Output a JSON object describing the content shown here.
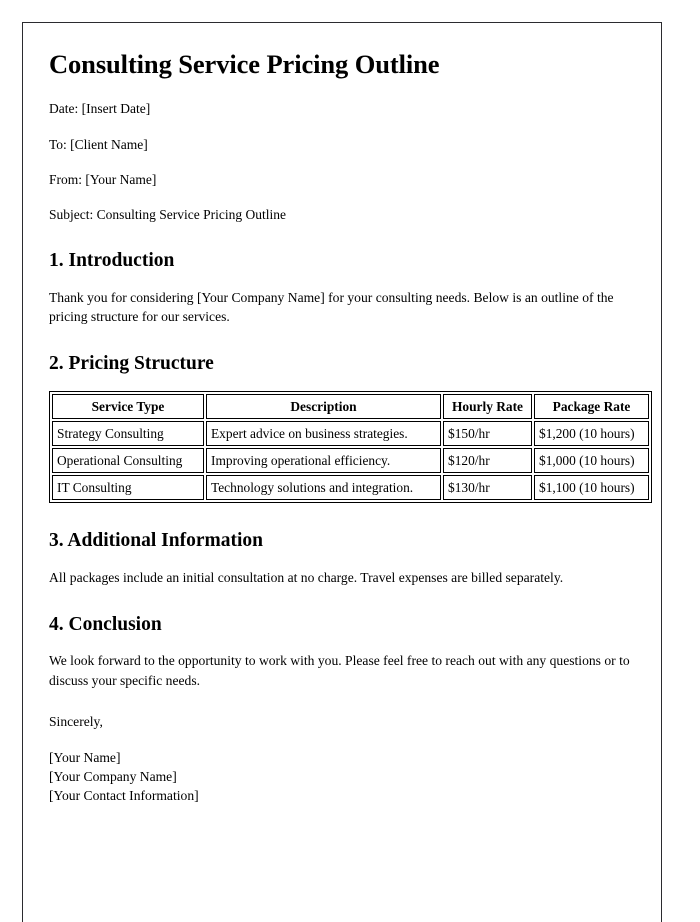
{
  "document": {
    "title": "Consulting Service Pricing Outline",
    "meta": [
      {
        "label": "Date",
        "text": "Date: [Insert Date]"
      },
      {
        "label": "To",
        "text": "To: [Client Name]"
      },
      {
        "label": "From",
        "text": "From: [Your Name]"
      },
      {
        "label": "Subject",
        "text": "Subject: Consulting Service Pricing Outline"
      }
    ],
    "sections": {
      "introduction": {
        "heading": "1. Introduction",
        "paragraph": "Thank you for considering [Your Company Name] for your consulting needs. Below is an outline of the pricing structure for our services."
      },
      "pricing_structure": {
        "heading": "2. Pricing Structure",
        "table": {
          "columns": [
            "Service Type",
            "Description",
            "Hourly Rate",
            "Package Rate"
          ],
          "rows": [
            {
              "service_type": "Strategy Consulting",
              "description": "Expert advice on business strategies.",
              "hourly_rate": "$150/hr",
              "package_rate": "$1,200 (10 hours)"
            },
            {
              "service_type": "Operational Consulting",
              "description": "Improving operational efficiency.",
              "hourly_rate": "$120/hr",
              "package_rate": "$1,000 (10 hours)"
            },
            {
              "service_type": "IT Consulting",
              "description": "Technology solutions and integration.",
              "hourly_rate": "$130/hr",
              "package_rate": "$1,100 (10 hours)"
            }
          ]
        }
      },
      "additional_information": {
        "heading": "3. Additional Information",
        "paragraph": "All packages include an initial consultation at no charge. Travel expenses are billed separately."
      },
      "conclusion": {
        "heading": "4. Conclusion",
        "paragraph": "We look forward to the opportunity to work with you. Please feel free to reach out with any questions or to discuss your specific needs.",
        "sign_off": "Sincerely,",
        "signature": [
          "[Your Name]",
          "[Your Company Name]",
          "[Your Contact Information]"
        ]
      }
    }
  },
  "colors": {
    "page_background": "#ffffff",
    "text": "#000000",
    "page_border": "#2b2b2f",
    "table_border": "#000000"
  }
}
